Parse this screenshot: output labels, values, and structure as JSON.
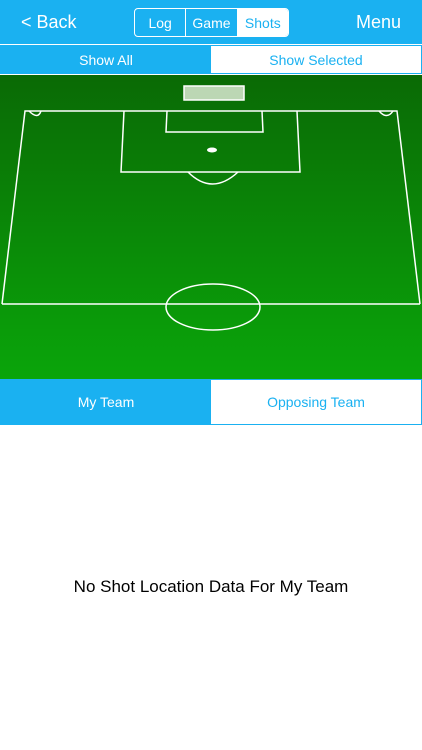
{
  "nav": {
    "back_label": "< Back",
    "menu_label": "Menu",
    "segments": [
      {
        "label": "Log",
        "active": false
      },
      {
        "label": "Game",
        "active": false
      },
      {
        "label": "Shots",
        "active": true
      }
    ]
  },
  "filter": {
    "show_all_label": "Show All",
    "show_selected_label": "Show Selected",
    "selected": "Show All"
  },
  "team": {
    "my_team_label": "My Team",
    "opposing_team_label": "Opposing Team",
    "selected": "My Team"
  },
  "message": "No Shot Location Data For My Team",
  "colors": {
    "accent": "#1ab1f1",
    "field_top": "#0a6a05",
    "field_bottom": "#0aa50a",
    "lines": "#ffffff"
  }
}
